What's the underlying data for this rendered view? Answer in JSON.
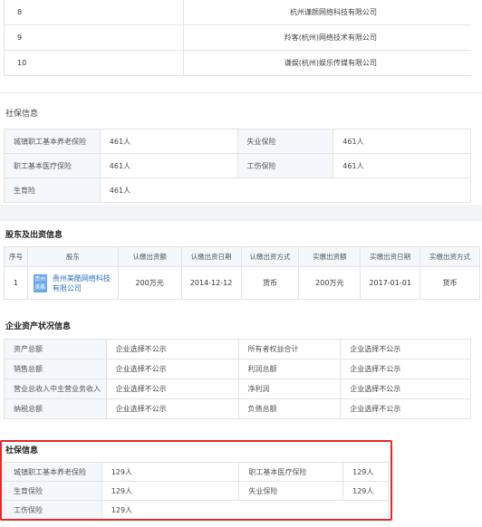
{
  "top_rows": [
    {
      "index": "8",
      "company": "杭州谦颜网络科技有限公司"
    },
    {
      "index": "9",
      "company": "羚客(杭州)网络技术有限公司"
    },
    {
      "index": "10",
      "company": "谦娱(杭州)娱乐传媒有限公司"
    }
  ],
  "social1": {
    "title": "社保信息",
    "rows": [
      [
        {
          "label": "城镇职工基本养老保险",
          "value": "461人"
        },
        {
          "label": "失业保险",
          "value": "461人"
        }
      ],
      [
        {
          "label": "职工基本医疗保险",
          "value": "461人"
        },
        {
          "label": "工伤保险",
          "value": "461人"
        }
      ],
      [
        {
          "label": "生育险",
          "value": "461人"
        }
      ]
    ]
  },
  "shareholders": {
    "title": "股东及出资信息",
    "headers": [
      "序号",
      "股东",
      "认缴出资额",
      "认缴出资日期",
      "认缴出资方式",
      "实缴出资额",
      "实缴出资日期",
      "实缴出资方式"
    ],
    "rows": [
      {
        "index": "1",
        "logo_text": "贵州 美酷",
        "name": "贵州美酷网络科技有限公司",
        "sub_amount": "200万元",
        "sub_date": "2014-12-12",
        "sub_method": "货币",
        "paid_amount": "200万元",
        "paid_date": "2017-01-01",
        "paid_method": "货币"
      }
    ]
  },
  "assets": {
    "title": "企业资产状况信息",
    "rows": [
      [
        {
          "label": "资产总额",
          "value": "企业选择不公示"
        },
        {
          "label": "所有者权益合计",
          "value": "企业选择不公示"
        }
      ],
      [
        {
          "label": "销售总额",
          "value": "企业选择不公示"
        },
        {
          "label": "利润总额",
          "value": "企业选择不公示"
        }
      ],
      [
        {
          "label": "营业总收入中主营业务收入",
          "value": "企业选择不公示"
        },
        {
          "label": "净利润",
          "value": "企业选择不公示"
        }
      ],
      [
        {
          "label": "纳税总额",
          "value": "企业选择不公示"
        },
        {
          "label": "负债总额",
          "value": "企业选择不公示"
        }
      ]
    ]
  },
  "social2": {
    "title": "社保信息",
    "rows": [
      [
        {
          "label": "城镇职工基本养老保险",
          "value": "129人"
        },
        {
          "label": "职工基本医疗保险",
          "value": "129人"
        }
      ],
      [
        {
          "label": "生育保险",
          "value": "129人"
        },
        {
          "label": "失业保险",
          "value": "129人"
        }
      ],
      [
        {
          "label": "工伤保险",
          "value": "129人"
        }
      ]
    ]
  },
  "colors": {
    "highlight_border": "#e22a2a",
    "label_bg": "#f4f8fc",
    "link": "#2e6fc2"
  }
}
